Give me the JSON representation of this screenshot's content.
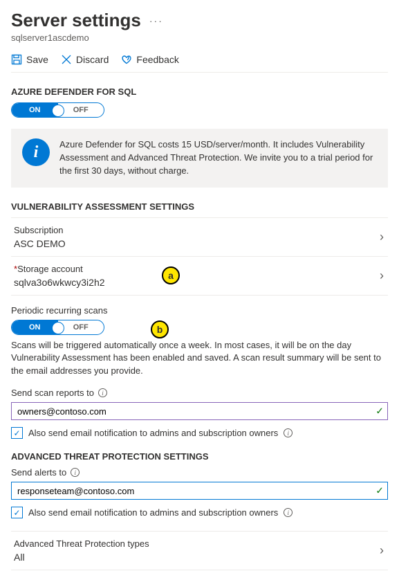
{
  "header": {
    "title": "Server settings",
    "subtitle": "sqlserver1ascdemo"
  },
  "toolbar": {
    "save": "Save",
    "discard": "Discard",
    "feedback": "Feedback"
  },
  "defender": {
    "heading": "AZURE DEFENDER FOR SQL",
    "toggle_on": "ON",
    "toggle_off": "OFF",
    "info": "Azure Defender for SQL costs 15 USD/server/month. It includes Vulnerability Assessment and Advanced Threat Protection. We invite you to a trial period for the first 30 days, without charge."
  },
  "va": {
    "heading": "VULNERABILITY ASSESSMENT SETTINGS",
    "subscription_label": "Subscription",
    "subscription_value": "ASC DEMO",
    "storage_label": "Storage account",
    "storage_value": "sqlva3o6wkwcy3i2h2",
    "periodic_label": "Periodic recurring scans",
    "toggle_on": "ON",
    "toggle_off": "OFF",
    "periodic_desc": "Scans will be triggered automatically once a week. In most cases, it will be on the day Vulnerability Assessment has been enabled and saved. A scan result summary will be sent to the email addresses you provide.",
    "reports_label": "Send scan reports to",
    "reports_value": "owners@contoso.com",
    "also_notify": "Also send email notification to admins and subscription owners"
  },
  "atp": {
    "heading": "ADVANCED THREAT PROTECTION SETTINGS",
    "alerts_label": "Send alerts to",
    "alerts_value": "responseteam@contoso.com",
    "also_notify": "Also send email notification to admins and subscription owners",
    "types_label": "Advanced Threat Protection types",
    "types_value": "All"
  },
  "callouts": {
    "a": "a",
    "b": "b"
  }
}
